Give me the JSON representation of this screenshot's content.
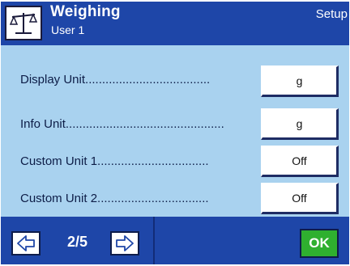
{
  "header": {
    "title": "Weighing",
    "subtitle": "User 1",
    "setup_label": "Setup",
    "icon": "balance-scale-icon"
  },
  "settings": [
    {
      "label": "Display Unit.....................................",
      "value": "g"
    },
    {
      "label": "Info Unit...............................................",
      "value": "g"
    },
    {
      "label": "Custom Unit 1.................................",
      "value": "Off"
    },
    {
      "label": "Custom Unit 2.................................",
      "value": "Off"
    }
  ],
  "footer": {
    "prev_icon": "arrow-left-icon",
    "next_icon": "arrow-right-icon",
    "page_indicator": "2/5",
    "ok_label": "OK"
  },
  "colors": {
    "header_bg": "#1e46a8",
    "content_bg": "#a9d2ef",
    "ok_green": "#2fb02f"
  }
}
